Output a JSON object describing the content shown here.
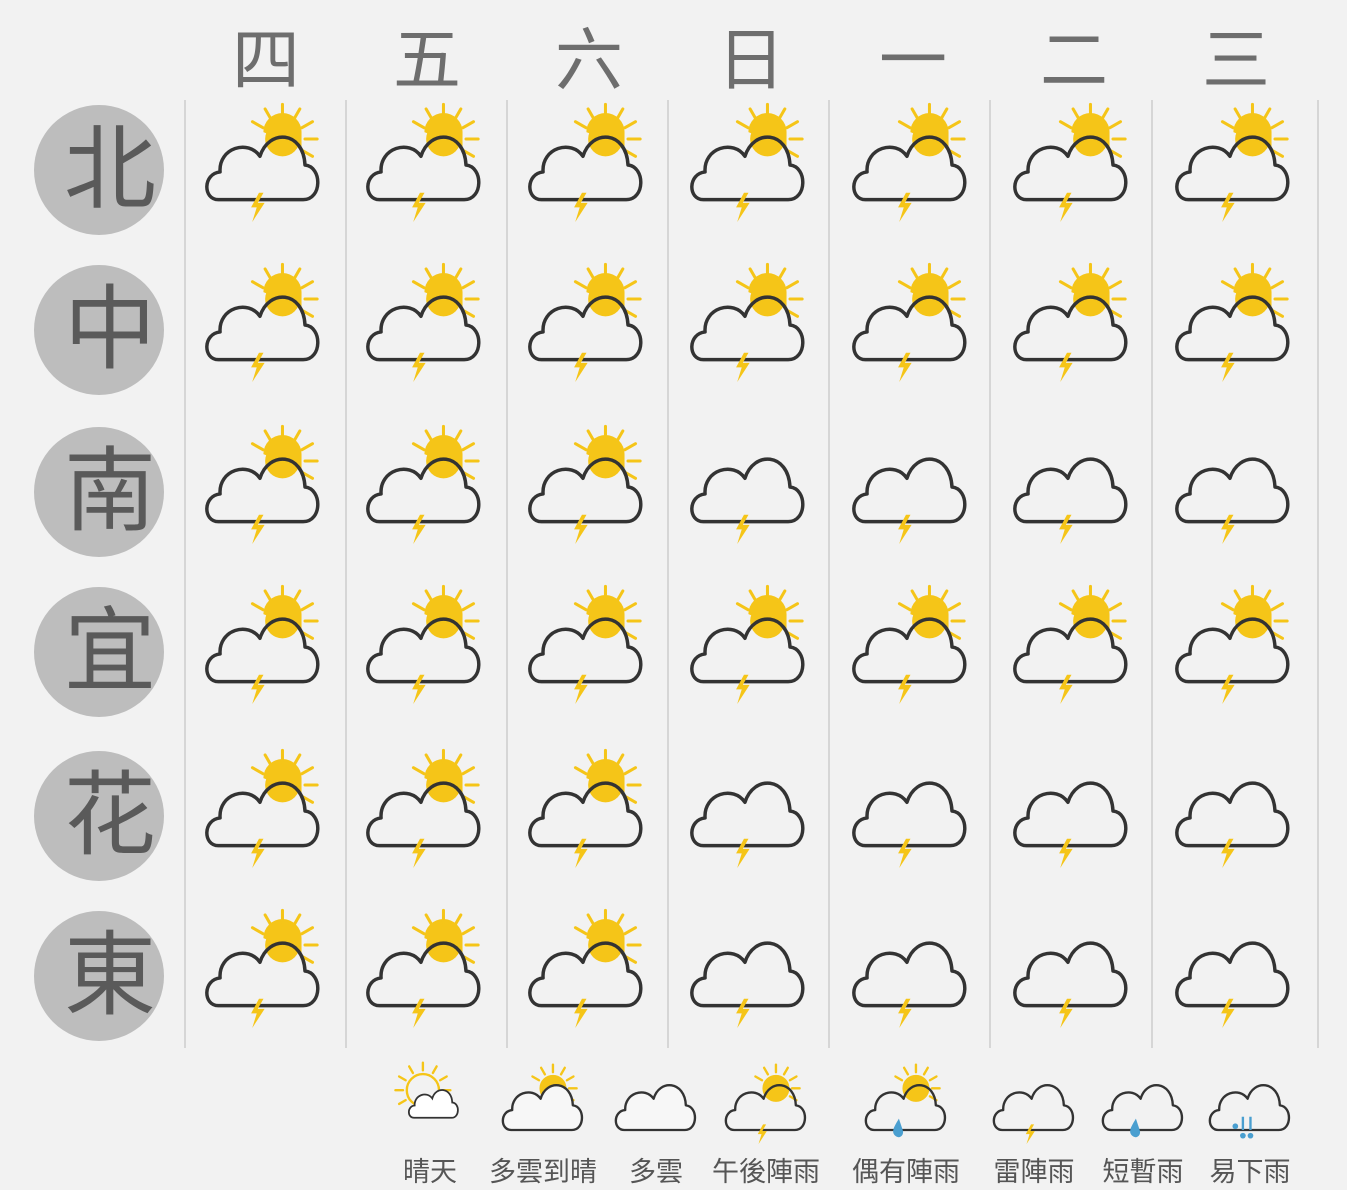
{
  "days": [
    "四",
    "五",
    "六",
    "日",
    "一",
    "二",
    "三"
  ],
  "regions": [
    {
      "name": "北",
      "forecast": [
        "afternoon-rain",
        "afternoon-rain",
        "afternoon-rain",
        "afternoon-rain",
        "afternoon-rain",
        "afternoon-rain",
        "afternoon-rain"
      ]
    },
    {
      "name": "中",
      "forecast": [
        "afternoon-rain",
        "afternoon-rain",
        "afternoon-rain",
        "afternoon-rain",
        "afternoon-rain",
        "afternoon-rain",
        "afternoon-rain"
      ]
    },
    {
      "name": "南",
      "forecast": [
        "afternoon-rain",
        "afternoon-rain",
        "afternoon-rain",
        "thunderstorm",
        "thunderstorm",
        "thunderstorm",
        "thunderstorm"
      ]
    },
    {
      "name": "宜",
      "forecast": [
        "afternoon-rain",
        "afternoon-rain",
        "afternoon-rain",
        "afternoon-rain",
        "afternoon-rain",
        "afternoon-rain",
        "afternoon-rain"
      ]
    },
    {
      "name": "花",
      "forecast": [
        "afternoon-rain",
        "afternoon-rain",
        "afternoon-rain",
        "thunderstorm",
        "thunderstorm",
        "thunderstorm",
        "thunderstorm"
      ]
    },
    {
      "name": "東",
      "forecast": [
        "afternoon-rain",
        "afternoon-rain",
        "afternoon-rain",
        "thunderstorm",
        "thunderstorm",
        "thunderstorm",
        "thunderstorm"
      ]
    }
  ],
  "legend": [
    {
      "icon": "sunny",
      "label": "晴天"
    },
    {
      "icon": "partly-cloudy",
      "label": "多雲到晴"
    },
    {
      "icon": "cloudy",
      "label": "多雲"
    },
    {
      "icon": "afternoon-rain",
      "label": "午後陣雨"
    },
    {
      "icon": "occasional-showers",
      "label": "偶有陣雨"
    },
    {
      "icon": "thunderstorm",
      "label": "雷陣雨"
    },
    {
      "icon": "brief-rain",
      "label": "短暫雨"
    },
    {
      "icon": "rain",
      "label": "易下雨"
    }
  ],
  "colors": {
    "sun": "#f5c518",
    "cloud_stroke": "#333333",
    "bolt": "#f5c518",
    "rain": "#4a9fd0"
  }
}
